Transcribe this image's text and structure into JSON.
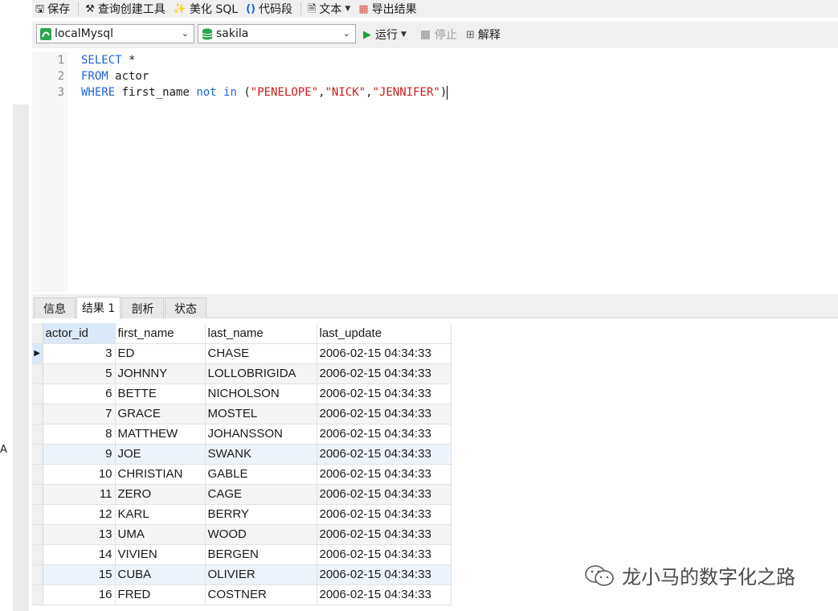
{
  "toolbar": {
    "save_label": "保存",
    "query_builder_label": "查询创建工具",
    "beautify_label": "美化 SQL",
    "snippet_label": "代码段",
    "text_label": "文本",
    "export_label": "导出结果"
  },
  "connection": {
    "selected": "localMysql"
  },
  "database": {
    "selected": "sakila"
  },
  "run": {
    "run_label": "运行",
    "stop_label": "停止",
    "explain_label": "解释"
  },
  "editor": {
    "lines": [
      {
        "num": "1",
        "kw1": "SELECT",
        "rest": " *"
      },
      {
        "num": "2",
        "kw1": "FROM",
        "rest": " actor"
      },
      {
        "num": "3",
        "kw1": "WHERE",
        "mid": " first_name ",
        "kw2": "not",
        "sp": " ",
        "kw3": "in",
        "pre": " (",
        "s1": "\"PENELOPE\"",
        "c1": ",",
        "s2": "\"NICK\"",
        "c2": ",",
        "s3": "\"JENNIFER\"",
        "end": ")"
      }
    ]
  },
  "result_tabs": [
    "信息",
    "结果 1",
    "剖析",
    "状态"
  ],
  "grid": {
    "columns": [
      "actor_id",
      "first_name",
      "last_name",
      "last_update"
    ],
    "rows": [
      [
        "3",
        "ED",
        "CHASE",
        "2006-02-15 04:34:33"
      ],
      [
        "5",
        "JOHNNY",
        "LOLLOBRIGIDA",
        "2006-02-15 04:34:33"
      ],
      [
        "6",
        "BETTE",
        "NICHOLSON",
        "2006-02-15 04:34:33"
      ],
      [
        "7",
        "GRACE",
        "MOSTEL",
        "2006-02-15 04:34:33"
      ],
      [
        "8",
        "MATTHEW",
        "JOHANSSON",
        "2006-02-15 04:34:33"
      ],
      [
        "9",
        "JOE",
        "SWANK",
        "2006-02-15 04:34:33"
      ],
      [
        "10",
        "CHRISTIAN",
        "GABLE",
        "2006-02-15 04:34:33"
      ],
      [
        "11",
        "ZERO",
        "CAGE",
        "2006-02-15 04:34:33"
      ],
      [
        "12",
        "KARL",
        "BERRY",
        "2006-02-15 04:34:33"
      ],
      [
        "13",
        "UMA",
        "WOOD",
        "2006-02-15 04:34:33"
      ],
      [
        "14",
        "VIVIEN",
        "BERGEN",
        "2006-02-15 04:34:33"
      ],
      [
        "15",
        "CUBA",
        "OLIVIER",
        "2006-02-15 04:34:33"
      ],
      [
        "16",
        "FRED",
        "COSTNER",
        "2006-02-15 04:34:33"
      ]
    ]
  },
  "side_letter": "A",
  "watermark": {
    "text": "龙小马的数字化之路"
  },
  "colors": {
    "keyword": "#1e63d6",
    "string": "#cc1a1a",
    "run_green": "#1f9e3a",
    "db_green": "#2da44e"
  }
}
